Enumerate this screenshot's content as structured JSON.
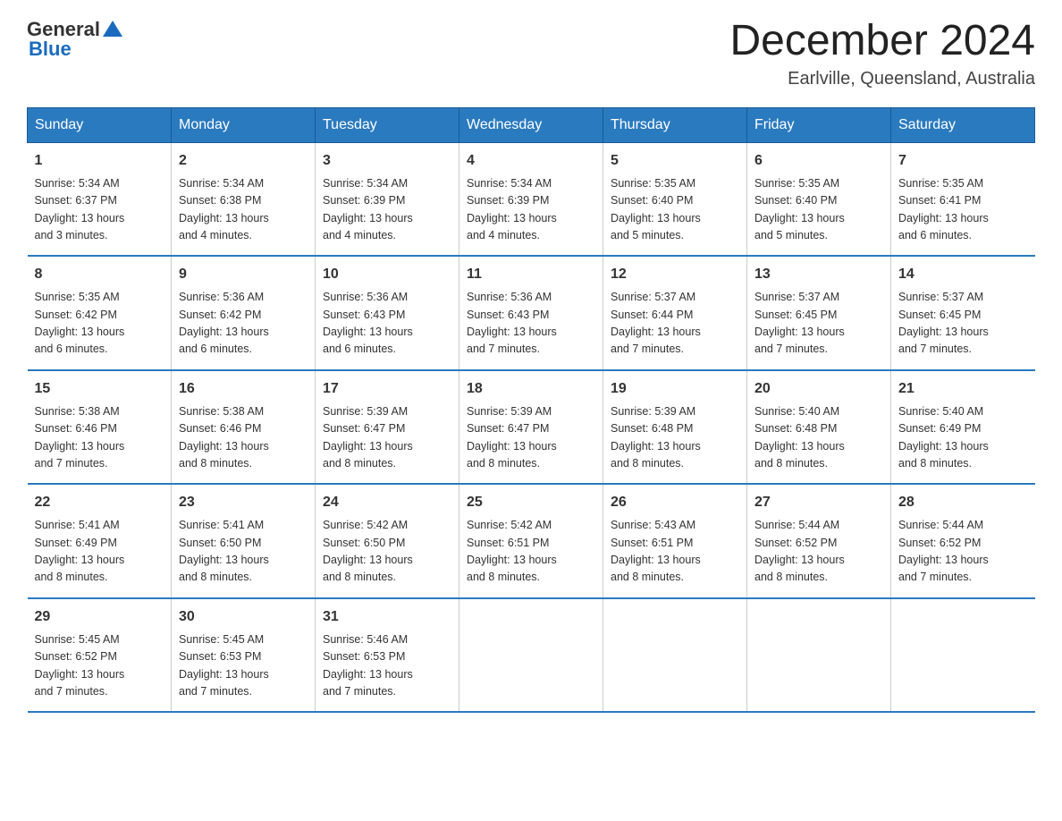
{
  "header": {
    "logo_general": "General",
    "logo_blue": "Blue",
    "month_title": "December 2024",
    "location": "Earlville, Queensland, Australia"
  },
  "days_of_week": [
    "Sunday",
    "Monday",
    "Tuesday",
    "Wednesday",
    "Thursday",
    "Friday",
    "Saturday"
  ],
  "weeks": [
    [
      {
        "day": "1",
        "sunrise": "5:34 AM",
        "sunset": "6:37 PM",
        "daylight": "13 hours and 3 minutes."
      },
      {
        "day": "2",
        "sunrise": "5:34 AM",
        "sunset": "6:38 PM",
        "daylight": "13 hours and 4 minutes."
      },
      {
        "day": "3",
        "sunrise": "5:34 AM",
        "sunset": "6:39 PM",
        "daylight": "13 hours and 4 minutes."
      },
      {
        "day": "4",
        "sunrise": "5:34 AM",
        "sunset": "6:39 PM",
        "daylight": "13 hours and 4 minutes."
      },
      {
        "day": "5",
        "sunrise": "5:35 AM",
        "sunset": "6:40 PM",
        "daylight": "13 hours and 5 minutes."
      },
      {
        "day": "6",
        "sunrise": "5:35 AM",
        "sunset": "6:40 PM",
        "daylight": "13 hours and 5 minutes."
      },
      {
        "day": "7",
        "sunrise": "5:35 AM",
        "sunset": "6:41 PM",
        "daylight": "13 hours and 6 minutes."
      }
    ],
    [
      {
        "day": "8",
        "sunrise": "5:35 AM",
        "sunset": "6:42 PM",
        "daylight": "13 hours and 6 minutes."
      },
      {
        "day": "9",
        "sunrise": "5:36 AM",
        "sunset": "6:42 PM",
        "daylight": "13 hours and 6 minutes."
      },
      {
        "day": "10",
        "sunrise": "5:36 AM",
        "sunset": "6:43 PM",
        "daylight": "13 hours and 6 minutes."
      },
      {
        "day": "11",
        "sunrise": "5:36 AM",
        "sunset": "6:43 PM",
        "daylight": "13 hours and 7 minutes."
      },
      {
        "day": "12",
        "sunrise": "5:37 AM",
        "sunset": "6:44 PM",
        "daylight": "13 hours and 7 minutes."
      },
      {
        "day": "13",
        "sunrise": "5:37 AM",
        "sunset": "6:45 PM",
        "daylight": "13 hours and 7 minutes."
      },
      {
        "day": "14",
        "sunrise": "5:37 AM",
        "sunset": "6:45 PM",
        "daylight": "13 hours and 7 minutes."
      }
    ],
    [
      {
        "day": "15",
        "sunrise": "5:38 AM",
        "sunset": "6:46 PM",
        "daylight": "13 hours and 7 minutes."
      },
      {
        "day": "16",
        "sunrise": "5:38 AM",
        "sunset": "6:46 PM",
        "daylight": "13 hours and 8 minutes."
      },
      {
        "day": "17",
        "sunrise": "5:39 AM",
        "sunset": "6:47 PM",
        "daylight": "13 hours and 8 minutes."
      },
      {
        "day": "18",
        "sunrise": "5:39 AM",
        "sunset": "6:47 PM",
        "daylight": "13 hours and 8 minutes."
      },
      {
        "day": "19",
        "sunrise": "5:39 AM",
        "sunset": "6:48 PM",
        "daylight": "13 hours and 8 minutes."
      },
      {
        "day": "20",
        "sunrise": "5:40 AM",
        "sunset": "6:48 PM",
        "daylight": "13 hours and 8 minutes."
      },
      {
        "day": "21",
        "sunrise": "5:40 AM",
        "sunset": "6:49 PM",
        "daylight": "13 hours and 8 minutes."
      }
    ],
    [
      {
        "day": "22",
        "sunrise": "5:41 AM",
        "sunset": "6:49 PM",
        "daylight": "13 hours and 8 minutes."
      },
      {
        "day": "23",
        "sunrise": "5:41 AM",
        "sunset": "6:50 PM",
        "daylight": "13 hours and 8 minutes."
      },
      {
        "day": "24",
        "sunrise": "5:42 AM",
        "sunset": "6:50 PM",
        "daylight": "13 hours and 8 minutes."
      },
      {
        "day": "25",
        "sunrise": "5:42 AM",
        "sunset": "6:51 PM",
        "daylight": "13 hours and 8 minutes."
      },
      {
        "day": "26",
        "sunrise": "5:43 AM",
        "sunset": "6:51 PM",
        "daylight": "13 hours and 8 minutes."
      },
      {
        "day": "27",
        "sunrise": "5:44 AM",
        "sunset": "6:52 PM",
        "daylight": "13 hours and 8 minutes."
      },
      {
        "day": "28",
        "sunrise": "5:44 AM",
        "sunset": "6:52 PM",
        "daylight": "13 hours and 7 minutes."
      }
    ],
    [
      {
        "day": "29",
        "sunrise": "5:45 AM",
        "sunset": "6:52 PM",
        "daylight": "13 hours and 7 minutes."
      },
      {
        "day": "30",
        "sunrise": "5:45 AM",
        "sunset": "6:53 PM",
        "daylight": "13 hours and 7 minutes."
      },
      {
        "day": "31",
        "sunrise": "5:46 AM",
        "sunset": "6:53 PM",
        "daylight": "13 hours and 7 minutes."
      },
      null,
      null,
      null,
      null
    ]
  ],
  "labels": {
    "sunrise": "Sunrise:",
    "sunset": "Sunset:",
    "daylight": "Daylight:"
  },
  "colors": {
    "header_bg": "#2a7abf",
    "border": "#2a7abf"
  }
}
